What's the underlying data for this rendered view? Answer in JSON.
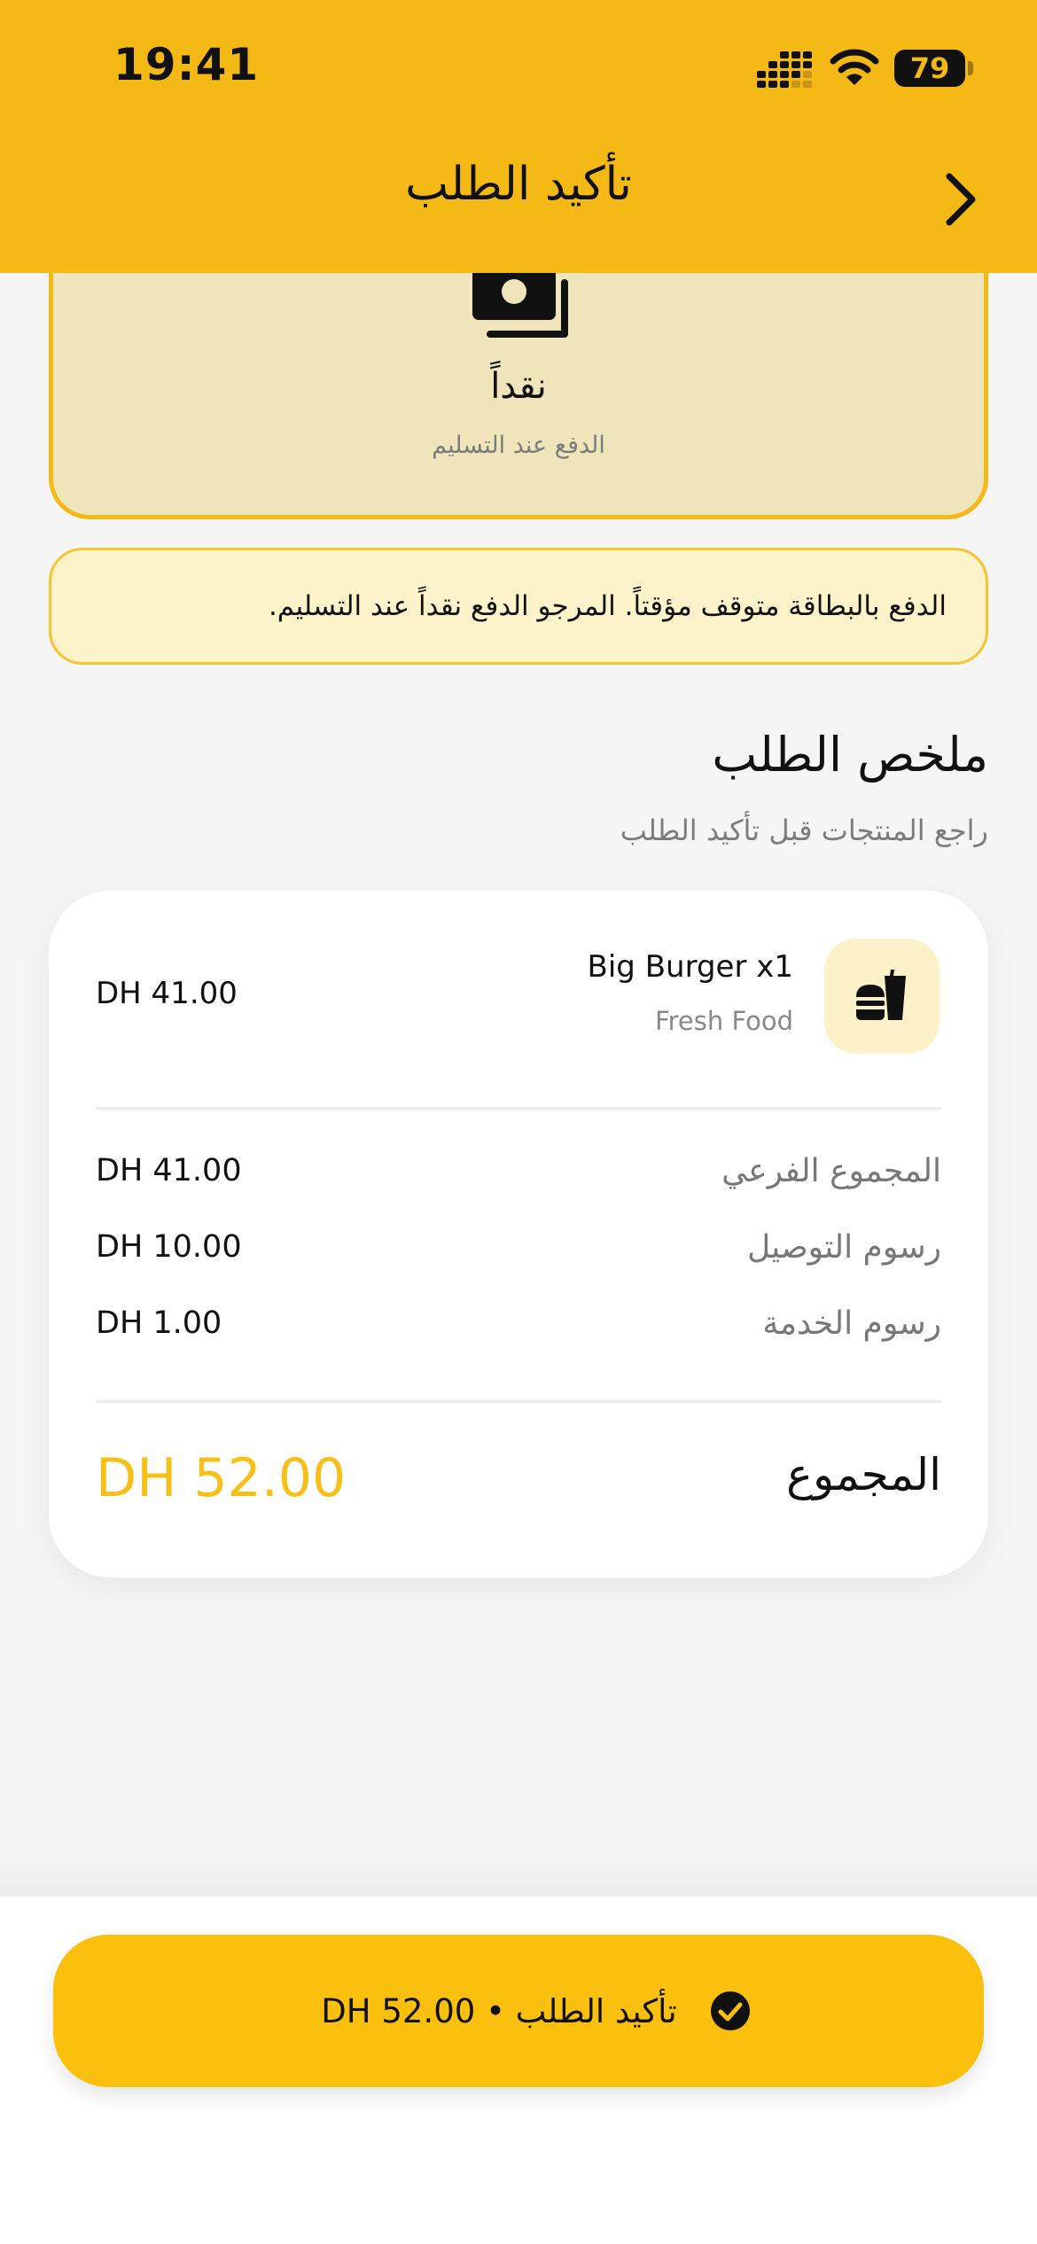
{
  "status_bar": {
    "time": "19:41",
    "battery": "79",
    "icons": [
      "cellular-signal-icon",
      "wifi-icon",
      "battery-icon"
    ]
  },
  "header": {
    "title": "تأكيد الطلب",
    "back_icon": "chevron-right-icon"
  },
  "payment_method": {
    "icon": "cash-icon",
    "title": "نقداً",
    "subtitle": "الدفع عند التسليم"
  },
  "notice": {
    "text": "الدفع بالبطاقة متوقف مؤقتاً. المرجو الدفع نقداً عند التسليم."
  },
  "summary": {
    "title": "ملخص الطلب",
    "subtitle": "راجع المنتجات قبل تأكيد الطلب",
    "items": [
      {
        "name": "Big Burger x1",
        "vendor": "Fresh Food",
        "price": "DH 41.00",
        "icon": "fastfood-icon"
      }
    ],
    "rows": [
      {
        "label": "المجموع الفرعي",
        "value": "DH 41.00"
      },
      {
        "label": "رسوم التوصيل",
        "value": "DH 10.00"
      },
      {
        "label": "رسوم الخدمة",
        "value": "DH 1.00"
      }
    ],
    "total_label": "المجموع",
    "total_value": "DH 52.00"
  },
  "confirm_button": {
    "label": "تأكيد الطلب • 52.00 DH",
    "icon": "check-circle-icon"
  },
  "colors": {
    "brand_yellow": "#f4b914",
    "button_yellow": "#fbbf0d",
    "total_yellow": "#f6c018",
    "background": "#f5f5f6"
  }
}
